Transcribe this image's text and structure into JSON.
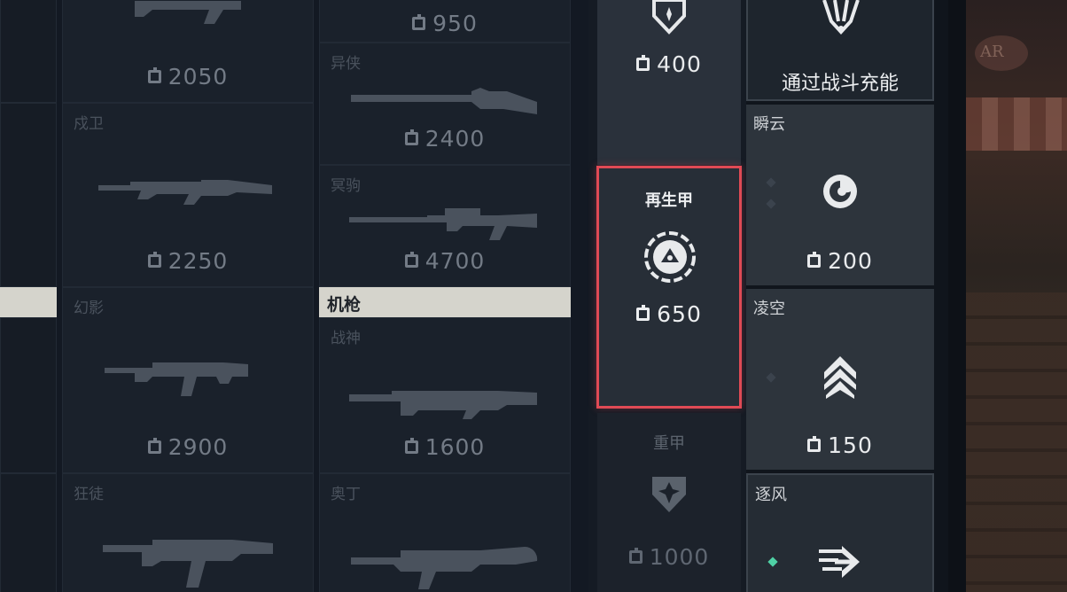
{
  "weapons": {
    "top_left_price": "2050",
    "top_right_price": "950",
    "col1": [
      {
        "name": "戍卫",
        "price": "2250"
      },
      {
        "name": "幻影",
        "price": "2900"
      },
      {
        "name": "狂徒",
        "price": ""
      }
    ],
    "col2": [
      {
        "name": "异侠",
        "price": "2400"
      },
      {
        "name": "冥驹",
        "price": "4700"
      },
      {
        "name": "战神",
        "price": "1600"
      },
      {
        "name": "奥丁",
        "price": ""
      }
    ],
    "section_header": "机枪"
  },
  "shields": {
    "top_price": "400",
    "selected": {
      "name": "再生甲",
      "price": "650"
    },
    "heavy": {
      "name": "重甲",
      "price": "1000"
    }
  },
  "abilities": {
    "top": {
      "label": "通过战斗充能"
    },
    "items": [
      {
        "name": "瞬云",
        "price": "200"
      },
      {
        "name": "凌空",
        "price": "150"
      },
      {
        "name": "逐风",
        "price": ""
      }
    ]
  },
  "scene": {
    "sign_text": "AR"
  },
  "colors": {
    "selected_border": "#e04a55",
    "charge_dot": "#4fd1a5"
  }
}
